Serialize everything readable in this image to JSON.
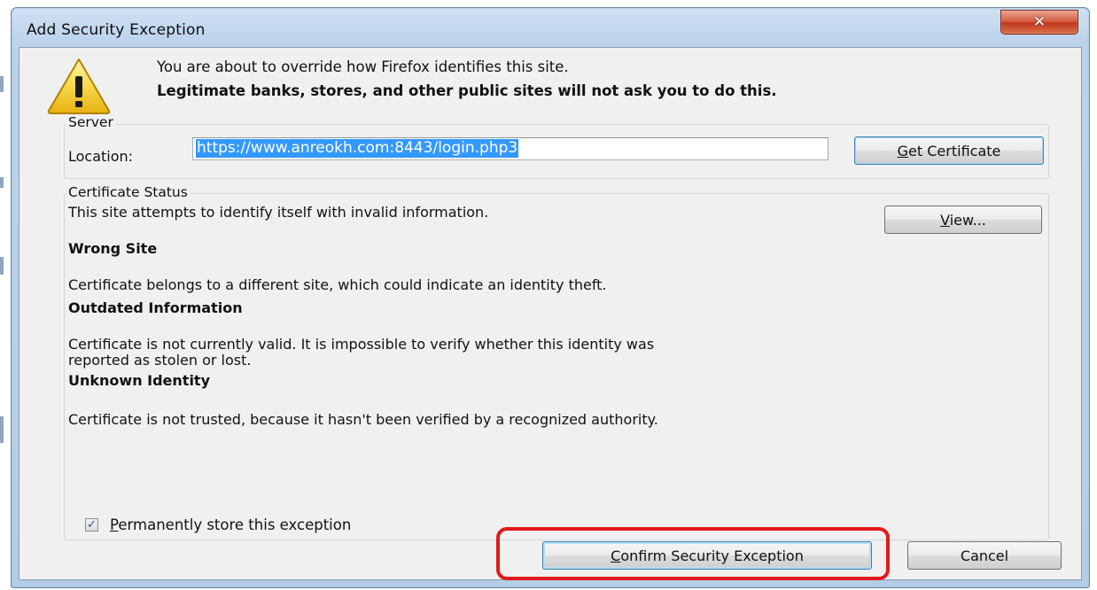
{
  "window": {
    "title": "Add Security Exception",
    "close_glyph": "✕"
  },
  "header": {
    "icon": "warning-icon",
    "line1": "You are about to override how Firefox identifies this site.",
    "line2": "Legitimate banks, stores, and other public sites will not ask you to do this."
  },
  "server": {
    "group_label": "Server",
    "location_label": "Location:",
    "location_value": "https://www.anreokh.com:8443/login.php3",
    "get_certificate_label": "Get Certificate",
    "get_certificate_accel": "G",
    "get_certificate_rest": "et Certificate"
  },
  "status": {
    "group_label": "Certificate Status",
    "summary": "This site attempts to identify itself with invalid information.",
    "view_accel": "V",
    "view_rest": "iew...",
    "wrong_site_title": "Wrong Site",
    "wrong_site_text": "Certificate belongs to a different site, which could indicate an identity theft.",
    "outdated_title": "Outdated Information",
    "outdated_text_1": "Certificate is not currently valid. It is impossible to verify whether this identity was",
    "outdated_text_2": "reported as stolen or lost.",
    "unknown_title": "Unknown Identity",
    "unknown_text": "Certificate is not trusted, because it hasn't been verified by a recognized authority."
  },
  "permanent": {
    "checked": true,
    "check_glyph": "✓",
    "label_accel": "P",
    "label_rest": "ermanently store this exception"
  },
  "buttons": {
    "confirm_accel": "C",
    "confirm_rest": "onfirm Security Exception",
    "cancel_label": "Cancel"
  },
  "colors": {
    "highlight_ring": "#e21a1a",
    "selection": "#3399ff",
    "close_button": "#c0391e"
  }
}
